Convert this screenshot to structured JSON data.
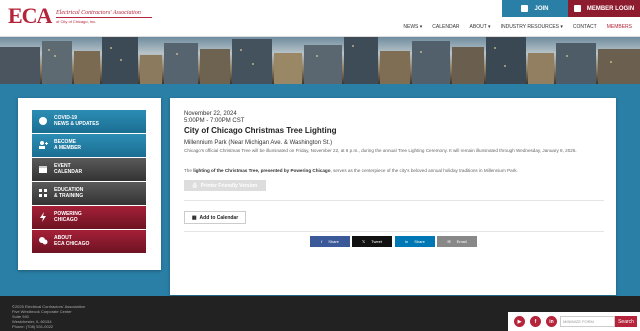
{
  "logo": {
    "mark": "ECA",
    "name": "Electrical Contractors' Association",
    "sub": "of City of Chicago, Inc."
  },
  "top_buttons": {
    "join": "JOIN",
    "login": "MEMBER LOGIN"
  },
  "nav": [
    {
      "label": "NEWS ▾"
    },
    {
      "label": "CALENDAR"
    },
    {
      "label": "ABOUT ▾"
    },
    {
      "label": "INDUSTRY RESOURCES ▾"
    },
    {
      "label": "CONTACT"
    },
    {
      "label": "MEMBERS"
    }
  ],
  "sidebar": [
    {
      "label1": "COVID-19",
      "label2": "NEWS & UPDATES",
      "icon": "chat-bubble-icon",
      "style": "teal"
    },
    {
      "label1": "BECOME",
      "label2": "A MEMBER",
      "icon": "add-user-icon",
      "style": "teal"
    },
    {
      "label1": "EVENT",
      "label2": "CALENDAR",
      "icon": "calendar-icon",
      "style": "gray"
    },
    {
      "label1": "EDUCATION",
      "label2": "& TRAINING",
      "icon": "grid-icon",
      "style": "gray"
    },
    {
      "label1": "POWERING",
      "label2": "CHICAGO",
      "icon": "lightning-icon",
      "style": "red"
    },
    {
      "label1": "ABOUT",
      "label2": "ECA CHICAGO",
      "icon": "chat-icon",
      "style": "red"
    }
  ],
  "event": {
    "date": "November 22, 2024",
    "time": "5:00PM - 7:00PM CST",
    "title": "City of Chicago Christmas Tree Lighting",
    "location": "Millennium Park (Near Michigan Ave. & Washington St.)",
    "description": "Chicago's official Christmas Tree will be illuminated on Friday, November 22, at 6 p.m., during the annual Tree Lighting Ceremony. It will remain illuminated through Wednesday, January 8, 2025.",
    "description2_a": "The ",
    "description2_b": "lighting of the Christmas Tree, presented by Powering Chicago",
    "description2_c": ", serves as the centerpiece of the city's beloved annual holiday traditions in Millennium Park.",
    "print_label": "Printer Friendly Version",
    "calendar_label": "Add to Calendar"
  },
  "share": {
    "facebook": "Share",
    "twitter": "Tweet",
    "linkedin": "Share",
    "email": "Email"
  },
  "footer": {
    "line1": "©2025 Electrical Contractors' Association",
    "line2": "Five Westbrook Corporate Center",
    "line3": "Suite 940",
    "line4": "Westchester, IL 60154",
    "line5": "Phone: (708) 531-0022",
    "search_placeholder": "MINIMIZE FORM",
    "search_button": "Search"
  }
}
